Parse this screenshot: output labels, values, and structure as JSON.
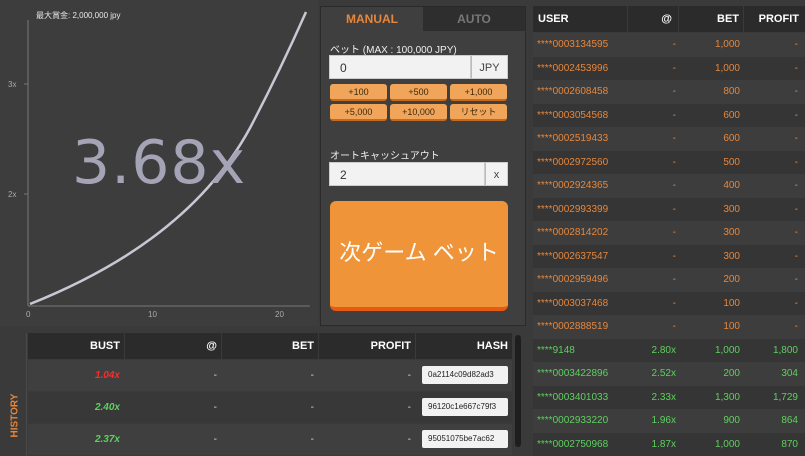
{
  "graph": {
    "max_payout": "最大賞金: 2,000,000 jpy",
    "multiplier": "3.68x",
    "y_ticks": [
      "3x",
      "2x"
    ],
    "x_ticks": [
      "0",
      "10",
      "20"
    ]
  },
  "bet_panel": {
    "tabs": [
      "MANUAL",
      "AUTO"
    ],
    "bet_label": "ベット (MAX : 100,000 JPY)",
    "bet_value": "0",
    "bet_unit": "JPY",
    "quick_buttons": [
      "+100",
      "+500",
      "+1,000",
      "+5,000",
      "+10,000",
      "リセット"
    ],
    "cashout_label": "オートキャッシュアウト",
    "cashout_value": "2",
    "cashout_unit": "x",
    "bet_button": "次ゲーム ベット"
  },
  "players": {
    "headers": [
      "USER",
      "@",
      "BET",
      "PROFIT"
    ],
    "rows": [
      {
        "user": "****0003134595",
        "at": "-",
        "bet": "1,000",
        "profit": "-",
        "status": "pending"
      },
      {
        "user": "****0002453996",
        "at": "-",
        "bet": "1,000",
        "profit": "-",
        "status": "pending"
      },
      {
        "user": "****0002608458",
        "at": "-",
        "bet": "800",
        "profit": "-",
        "status": "pending"
      },
      {
        "user": "****0003054568",
        "at": "-",
        "bet": "600",
        "profit": "-",
        "status": "pending"
      },
      {
        "user": "****0002519433",
        "at": "-",
        "bet": "600",
        "profit": "-",
        "status": "pending"
      },
      {
        "user": "****0002972560",
        "at": "-",
        "bet": "500",
        "profit": "-",
        "status": "pending"
      },
      {
        "user": "****0002924365",
        "at": "-",
        "bet": "400",
        "profit": "-",
        "status": "pending"
      },
      {
        "user": "****0002993399",
        "at": "-",
        "bet": "300",
        "profit": "-",
        "status": "pending"
      },
      {
        "user": "****0002814202",
        "at": "-",
        "bet": "300",
        "profit": "-",
        "status": "pending"
      },
      {
        "user": "****0002637547",
        "at": "-",
        "bet": "300",
        "profit": "-",
        "status": "pending"
      },
      {
        "user": "****0002959496",
        "at": "-",
        "bet": "200",
        "profit": "-",
        "status": "pending"
      },
      {
        "user": "****0003037468",
        "at": "-",
        "bet": "100",
        "profit": "-",
        "status": "pending"
      },
      {
        "user": "****0002888519",
        "at": "-",
        "bet": "100",
        "profit": "-",
        "status": "pending"
      },
      {
        "user": "****9148",
        "at": "2.80x",
        "bet": "1,000",
        "profit": "1,800",
        "status": "won"
      },
      {
        "user": "****0003422896",
        "at": "2.52x",
        "bet": "200",
        "profit": "304",
        "status": "won"
      },
      {
        "user": "****0003401033",
        "at": "2.33x",
        "bet": "1,300",
        "profit": "1,729",
        "status": "won"
      },
      {
        "user": "****0002933220",
        "at": "1.96x",
        "bet": "900",
        "profit": "864",
        "status": "won"
      },
      {
        "user": "****0002750968",
        "at": "1.87x",
        "bet": "1,000",
        "profit": "870",
        "status": "won"
      }
    ]
  },
  "history": {
    "side_label": "HISTORY",
    "headers": [
      "BUST",
      "@",
      "BET",
      "PROFIT",
      "HASH"
    ],
    "rows": [
      {
        "bust": "1.04x",
        "at": "-",
        "bet": "-",
        "profit": "-",
        "hash": "0a2114c09d82ad3",
        "color": "red"
      },
      {
        "bust": "2.40x",
        "at": "-",
        "bet": "-",
        "profit": "-",
        "hash": "96120c1e667c79f3",
        "color": "green"
      },
      {
        "bust": "2.37x",
        "at": "-",
        "bet": "-",
        "profit": "-",
        "hash": "95051075be7ac62",
        "color": "green"
      }
    ]
  },
  "colors": {
    "orange": "#e8863a",
    "green": "#5ed05e",
    "red": "#ff2a2a"
  }
}
